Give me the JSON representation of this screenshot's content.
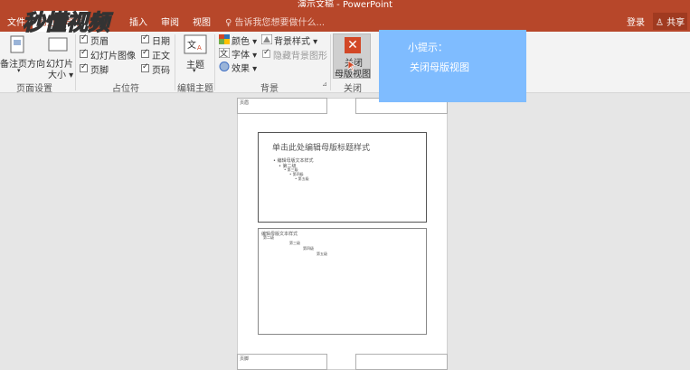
{
  "window": {
    "title": "演示文稿 - PowerPoint"
  },
  "tabs": [
    {
      "label": "文件"
    },
    {
      "label": "幻灯片母版"
    },
    {
      "label": "插入"
    },
    {
      "label": "审阅"
    },
    {
      "label": "视图"
    }
  ],
  "tellme": "告诉我您想要做什么...",
  "account": {
    "signin": "登录",
    "share": "共享"
  },
  "watermark": "秒懂视频",
  "ribbon": {
    "page_setup": {
      "notes_orientation": "备注页方向",
      "slide_size": "幻灯片大小",
      "group": "页面设置"
    },
    "placeholders": {
      "header": "页眉",
      "slide_image": "幻灯片图像",
      "footer": "页脚",
      "date": "日期",
      "body": "正文",
      "page_number": "页码",
      "group": "占位符"
    },
    "edit_theme": {
      "theme": "主题",
      "group": "编辑主题"
    },
    "background": {
      "colors": "颜色",
      "fonts": "字体",
      "effects": "效果",
      "bg_styles": "背景样式",
      "hide_bg": "隐藏背景图形",
      "group": "背景"
    },
    "close": {
      "label_line1": "关闭",
      "label_line2": "母版视图",
      "group": "关闭"
    }
  },
  "tip": {
    "title": "小提示：",
    "body": "关闭母版视图"
  },
  "document": {
    "header_label": "页眉",
    "footer_label": "页脚",
    "slide_title": "单击此处编辑母版标题样式",
    "slide_levels": [
      "• 编辑母版文本样式",
      "• 第二级",
      "• 第三级",
      "• 第四级",
      "• 第五级"
    ],
    "notes_levels": [
      "编辑母版文本样式",
      "第二级",
      "第三级",
      "第四级",
      "第五级"
    ]
  },
  "colors": {
    "brand": "#b7472a",
    "tip": "#7fbcff",
    "close_icon": "#d24726"
  }
}
